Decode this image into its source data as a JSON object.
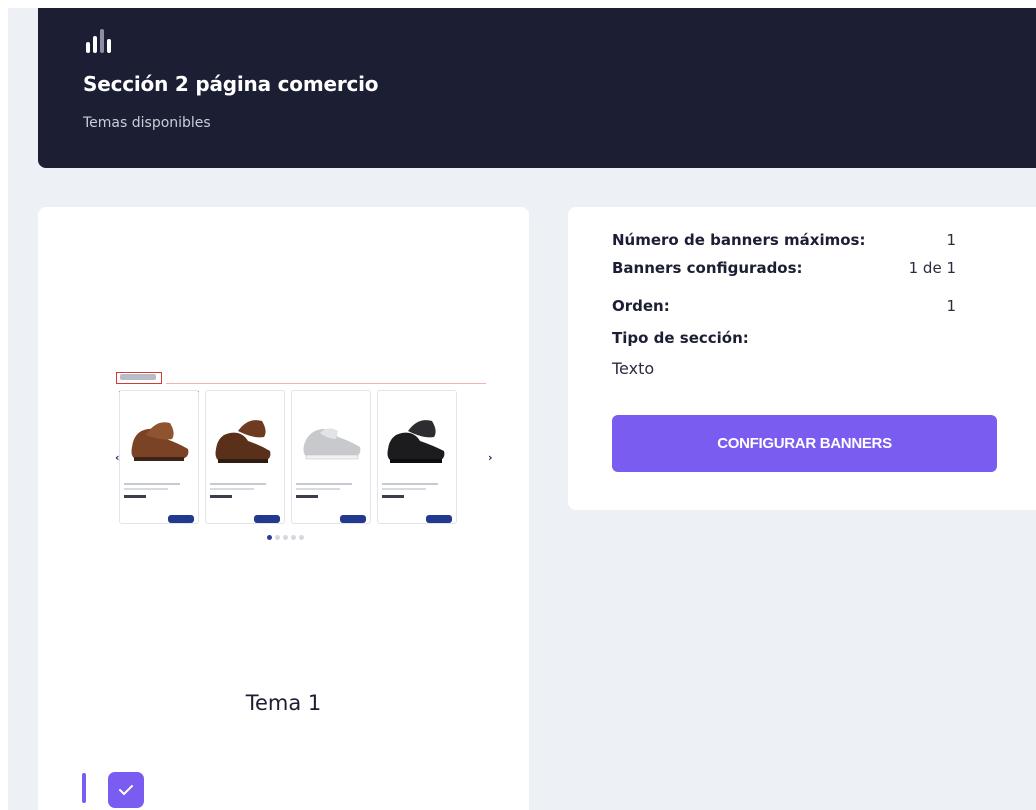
{
  "header": {
    "title": "Sección 2 página comercio",
    "subtitle": "Temas disponibles",
    "logo_icon": "bar-chart-logo-icon"
  },
  "theme": {
    "name": "Tema 1",
    "selected": true,
    "preview": {
      "product_count": 4,
      "carousel_dots": 5,
      "active_dot": 1
    }
  },
  "info": {
    "max_banners_label": "Número de banners máximos:",
    "max_banners_value": "1",
    "configured_label": "Banners configurados:",
    "configured_value": "1 de 1",
    "order_label": "Orden:",
    "order_value": "1",
    "section_type_label": "Tipo de sección:",
    "section_type_value": "Texto"
  },
  "actions": {
    "configure_label": "CONFIGURAR BANNERS"
  },
  "colors": {
    "header_bg": "#1c1e33",
    "accent": "#7a5cf0",
    "page_bg": "#edf0f5"
  }
}
